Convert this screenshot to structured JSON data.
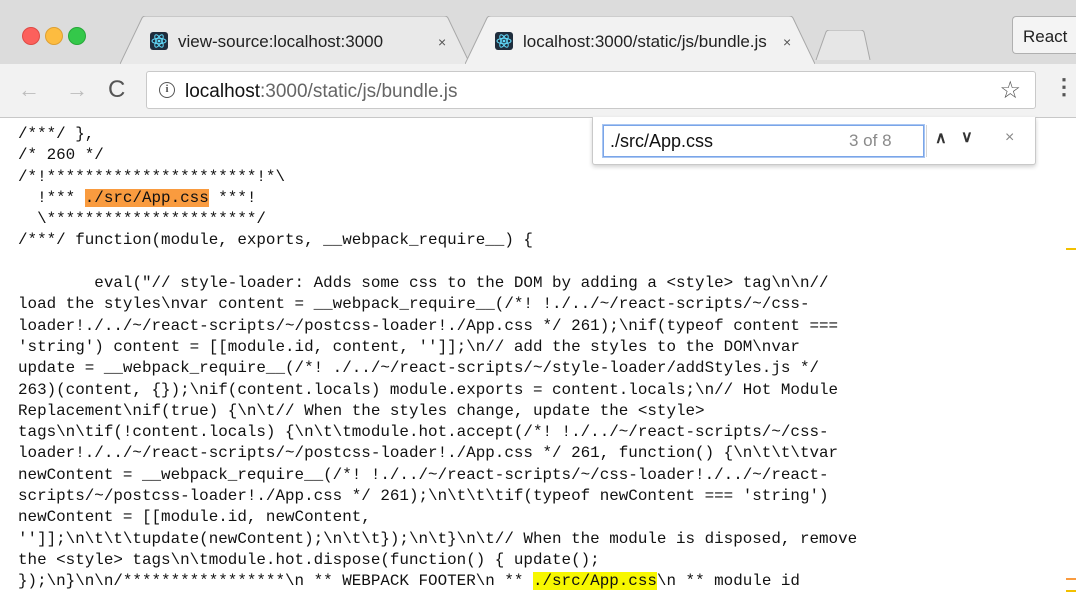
{
  "tabs": [
    {
      "title": "view-source:localhost:3000",
      "close": "×"
    },
    {
      "title": "localhost:3000/static/js/bundle.js",
      "close": "×"
    }
  ],
  "profile_button": "React",
  "toolbar": {
    "back": "←",
    "forward": "→",
    "reload": "C",
    "info": "i",
    "url_host": "localhost",
    "url_path": ":3000/static/js/bundle.js",
    "star": "☆",
    "menu": "⋮"
  },
  "find": {
    "query": "./src/App.css",
    "count": "3 of 8",
    "prev": "∧",
    "next": "∨",
    "close": "×"
  },
  "code": {
    "l1": "/***/ },",
    "l2": "/* 260 */",
    "l3": "/*!**********************!*\\",
    "l4a": "  !*** ",
    "l4b": "./src/App.css",
    "l4c": " ***!",
    "l5": "  \\**********************/",
    "l6": "/***/ function(module, exports, __webpack_require__) {",
    "l7": "",
    "l8": "\teval(\"// style-loader: Adds some css to the DOM by adding a <style> tag\\n\\n//",
    "l9": "load the styles\\nvar content = __webpack_require__(/*! !./../~/react-scripts/~/css-",
    "l10": "loader!./../~/react-scripts/~/postcss-loader!./App.css */ 261);\\nif(typeof content ===",
    "l11": "'string') content = [[module.id, content, '']];\\n// add the styles to the DOM\\nvar",
    "l12": "update = __webpack_require__(/*! ./../~/react-scripts/~/style-loader/addStyles.js */",
    "l13": "263)(content, {});\\nif(content.locals) module.exports = content.locals;\\n// Hot Module",
    "l14": "Replacement\\nif(true) {\\n\\t// When the styles change, update the <style>",
    "l15": "tags\\n\\tif(!content.locals) {\\n\\t\\tmodule.hot.accept(/*! !./../~/react-scripts/~/css-",
    "l16": "loader!./../~/react-scripts/~/postcss-loader!./App.css */ 261, function() {\\n\\t\\t\\tvar",
    "l17": "newContent = __webpack_require__(/*! !./../~/react-scripts/~/css-loader!./../~/react-",
    "l18": "scripts/~/postcss-loader!./App.css */ 261);\\n\\t\\t\\tif(typeof newContent === 'string')",
    "l19": "newContent = [[module.id, newContent,",
    "l20": "'']];\\n\\t\\t\\tupdate(newContent);\\n\\t\\t});\\n\\t}\\n\\t// When the module is disposed, remove",
    "l21": "the <style> tags\\n\\tmodule.hot.dispose(function() { update();",
    "l22a": "});\\n}\\n\\n/*****************\\n ** WEBPACK FOOTER\\n ** ",
    "l22b": "./src/App.css",
    "l22c": "\\n ** module id"
  },
  "colors": {
    "current_match": "#f99b3f",
    "other_match": "#f7f700"
  }
}
